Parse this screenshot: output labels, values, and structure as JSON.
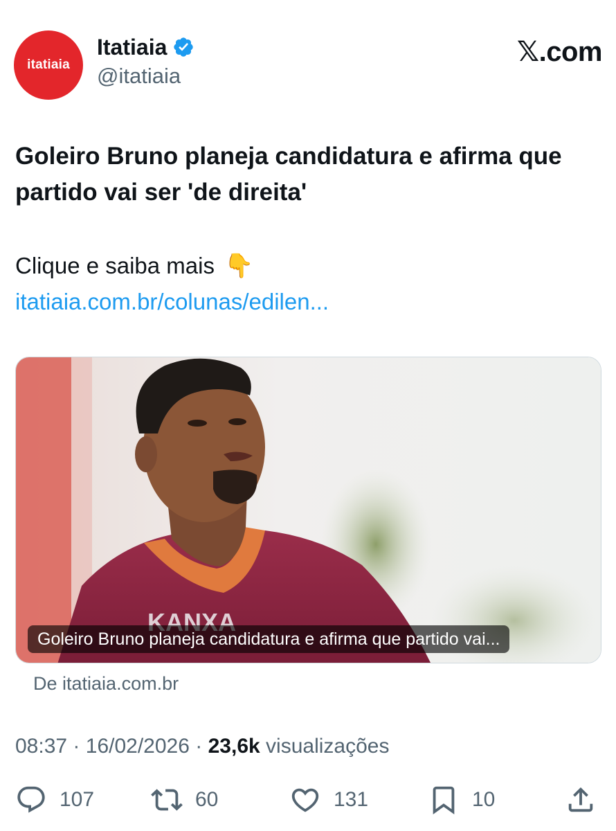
{
  "account": {
    "avatar_text": "itatiaia",
    "display_name": "Itatiaia",
    "handle": "@itatiaia",
    "verified": true,
    "brand_color": "#e3262b"
  },
  "platform_label": "𝕏.com",
  "post": {
    "headline": "Goleiro Bruno planeja candidatura e afirma que partido vai ser 'de direita'",
    "cta_text": "Clique e saiba mais",
    "cta_emoji": "👇",
    "link_text": "itatiaia.com.br/colunas/edilen...",
    "link_color": "#1d9bf0"
  },
  "card": {
    "caption": "Goleiro Bruno planeja candidatura e afirma que partido vai...",
    "source": "De itatiaia.com.br",
    "jersey_text": "KANXA"
  },
  "meta": {
    "time": "08:37",
    "separator": "·",
    "date": "16/02/2026",
    "views_count": "23,6k",
    "views_label": "visualizações"
  },
  "actions": {
    "replies": "107",
    "reposts": "60",
    "likes": "131",
    "bookmarks": "10"
  },
  "icons": [
    "verified-badge-icon",
    "reply-icon",
    "repost-icon",
    "like-icon",
    "bookmark-icon",
    "share-icon"
  ]
}
